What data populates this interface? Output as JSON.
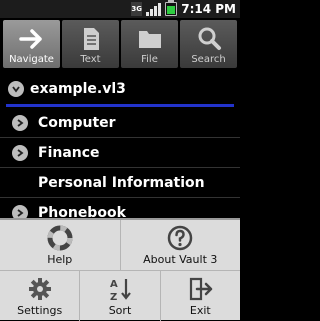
{
  "status": {
    "network": "3G",
    "time": "7:14 PM"
  },
  "tabs": [
    {
      "label": "Navigate",
      "icon": "arrow-right-icon",
      "active": true
    },
    {
      "label": "Text",
      "icon": "document-icon",
      "active": false
    },
    {
      "label": "File",
      "icon": "folder-icon",
      "active": false
    },
    {
      "label": "Search",
      "icon": "magnifier-icon",
      "active": false
    }
  ],
  "tree": {
    "root": "example.vl3",
    "items": [
      "Computer",
      "Finance",
      "Personal Information",
      "Phonebook"
    ]
  },
  "menu": {
    "items": [
      {
        "label": "Help",
        "icon": "lifebuoy-icon"
      },
      {
        "label": "About Vault 3",
        "icon": "question-icon"
      },
      {
        "label": "Settings",
        "icon": "gear-icon"
      },
      {
        "label": "Sort",
        "icon": "sort-az-icon"
      },
      {
        "label": "Exit",
        "icon": "exit-icon"
      }
    ]
  },
  "colors": {
    "accent_line": "#2233cc",
    "menu_bg": "#dcdcdc",
    "background": "#000000"
  }
}
